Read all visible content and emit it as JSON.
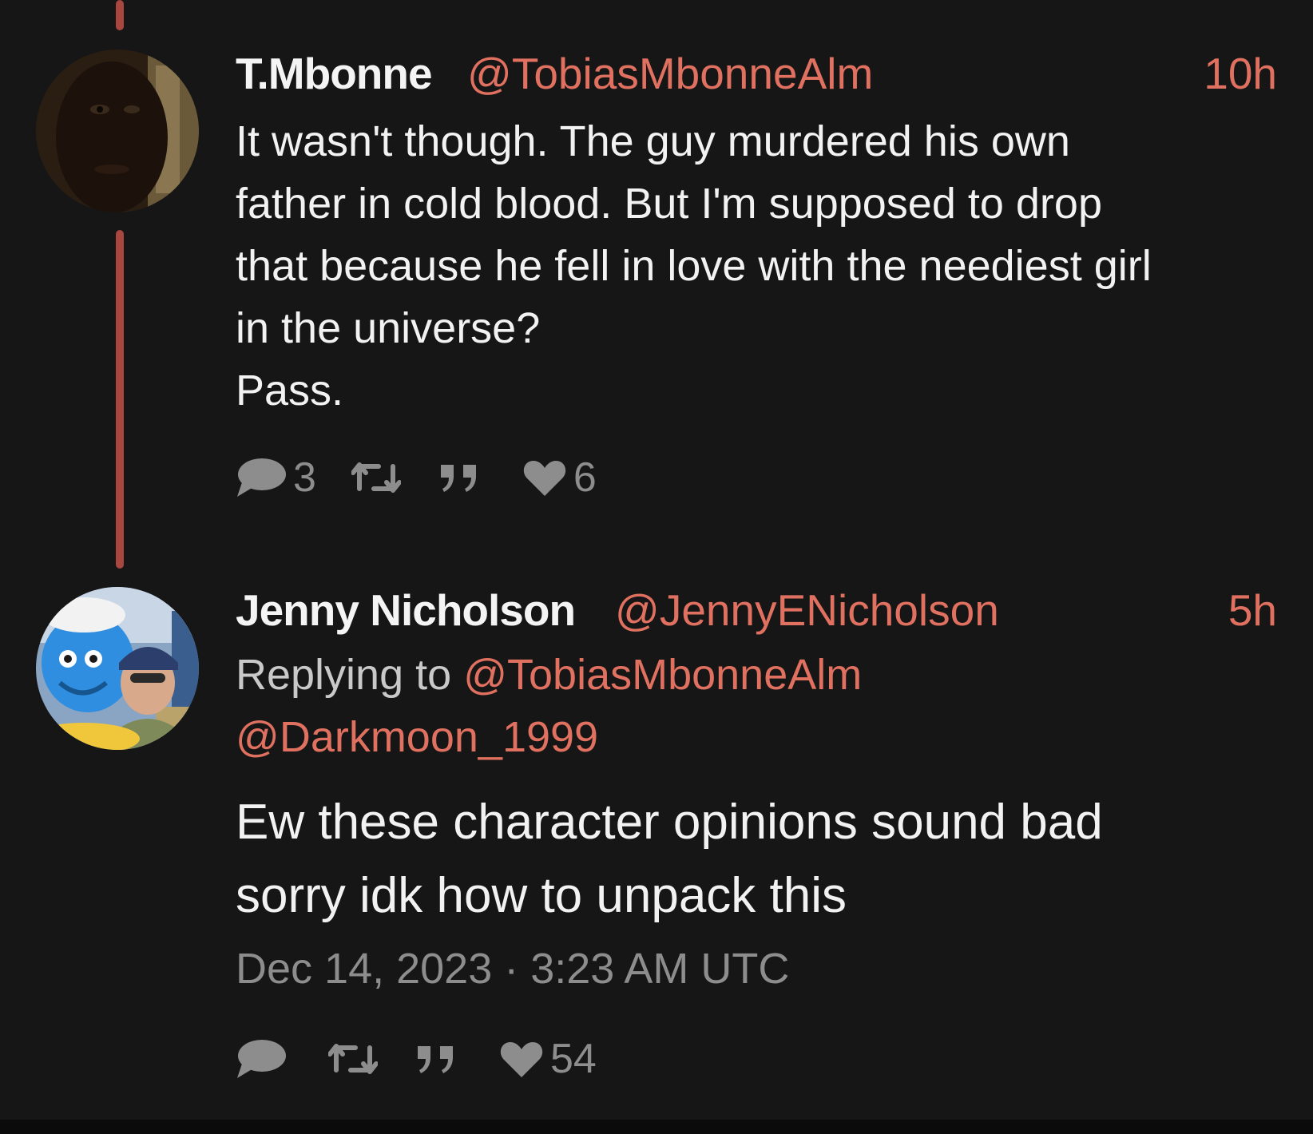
{
  "tweets": [
    {
      "display_name": "T.Mbonne",
      "handle": "@TobiasMbonneAlm",
      "time": "10h",
      "body_lines": [
        "It wasn't though. The guy murdered his own",
        "father in cold blood. But I'm supposed to drop",
        "that because he fell in love with the neediest girl",
        "in the universe?",
        "Pass."
      ],
      "reply_count": "3",
      "retweet_count": "",
      "quote_count": "",
      "like_count": "6"
    },
    {
      "display_name": "Jenny Nicholson",
      "handle": "@JennyENicholson",
      "time": "5h",
      "replying_prefix": "Replying to",
      "replying_mentions": [
        "@TobiasMbonneAlm",
        "@Darkmoon_1999"
      ],
      "body_lines": [
        "Ew these character opinions sound bad",
        "sorry idk how to unpack this"
      ],
      "timestamp": "Dec 14, 2023 · 3:23 AM UTC",
      "reply_count": "",
      "retweet_count": "",
      "quote_count": "",
      "like_count": "54"
    }
  ],
  "icons": {
    "reply": "comment-bubble-icon",
    "retweet": "retweet-icon",
    "quote": "quote-icon",
    "like": "heart-icon"
  },
  "colors": {
    "background": "#161616",
    "accent": "#e0705f",
    "thread_line": "#a8463f",
    "muted": "#8d8d8d",
    "text": "#f2f2f2"
  }
}
